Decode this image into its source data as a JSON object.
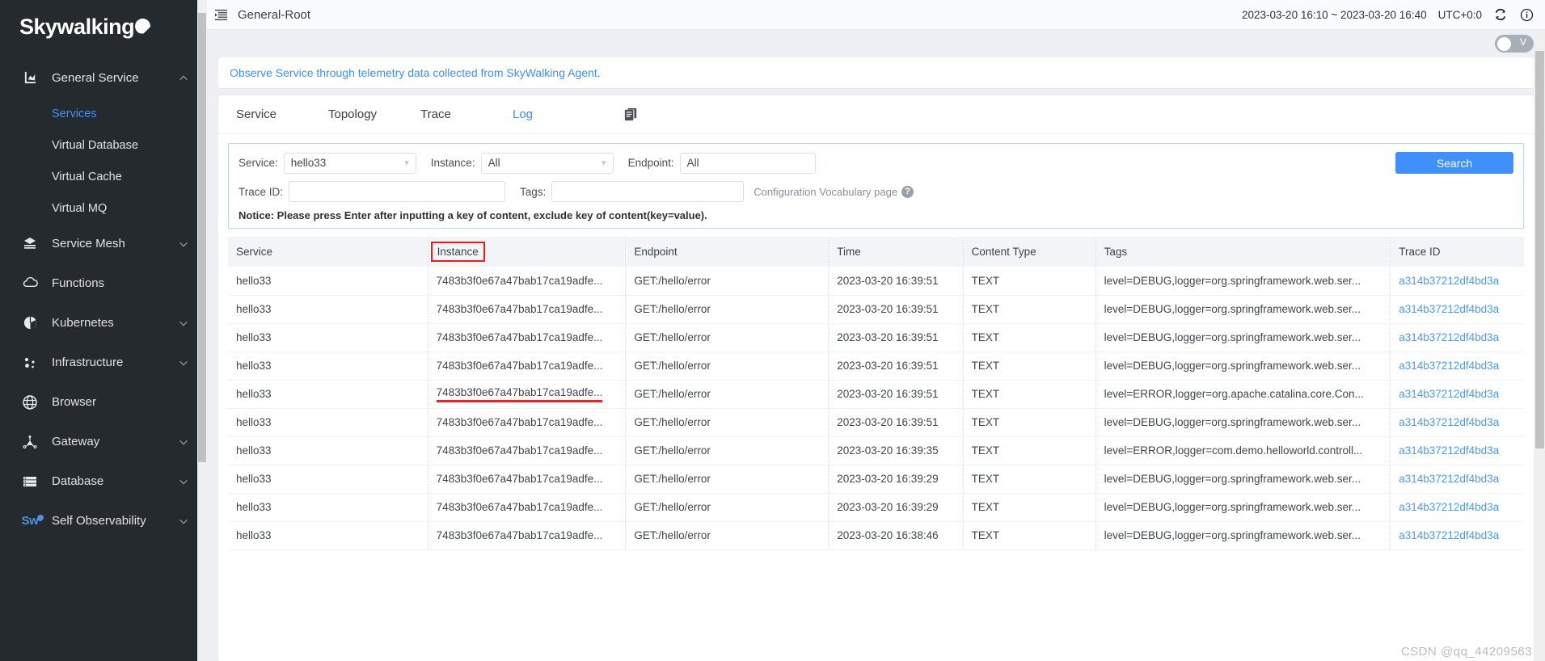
{
  "brand": {
    "name_part1": "Sky",
    "name_part2": "walking"
  },
  "sidebar": {
    "groups": [
      {
        "label": "General Service",
        "icon": "chart-icon",
        "expanded": true,
        "children": [
          {
            "label": "Services",
            "active": true
          },
          {
            "label": "Virtual Database",
            "active": false
          },
          {
            "label": "Virtual Cache",
            "active": false
          },
          {
            "label": "Virtual MQ",
            "active": false
          }
        ]
      },
      {
        "label": "Service Mesh",
        "icon": "mesh-icon",
        "expanded": false
      },
      {
        "label": "Functions",
        "icon": "cloud-icon",
        "expanded": null
      },
      {
        "label": "Kubernetes",
        "icon": "kubernetes-icon",
        "expanded": false
      },
      {
        "label": "Infrastructure",
        "icon": "infrastructure-icon",
        "expanded": false
      },
      {
        "label": "Browser",
        "icon": "globe-icon",
        "expanded": null
      },
      {
        "label": "Gateway",
        "icon": "gateway-icon",
        "expanded": false
      },
      {
        "label": "Database",
        "icon": "database-icon",
        "expanded": false
      },
      {
        "label": "Self Observability",
        "icon": "skywalking-mini-icon",
        "expanded": false
      }
    ]
  },
  "topbar": {
    "title": "General-Root",
    "time_range": "2023-03-20 16:10 ~ 2023-03-20 16:40",
    "timezone": "UTC+0:0",
    "reload_icon": "reload-icon",
    "info_icon": "info-icon",
    "collapse_icon": "collapse-sidebar-icon"
  },
  "viewswitch": {
    "label": "V"
  },
  "banner": {
    "text": "Observe Service through telemetry data collected from SkyWalking Agent."
  },
  "tabs": {
    "items": [
      {
        "label": "Service",
        "active": false
      },
      {
        "label": "Topology",
        "active": false
      },
      {
        "label": "Trace",
        "active": false
      },
      {
        "label": "Log",
        "active": true
      }
    ],
    "copy_icon": "copy-icon"
  },
  "search": {
    "service_label": "Service:",
    "service_value": "hello33",
    "instance_label": "Instance:",
    "instance_value": "All",
    "endpoint_label": "Endpoint:",
    "endpoint_value": "All",
    "traceid_label": "Trace ID:",
    "traceid_value": "",
    "traceid_placeholder": "",
    "tags_label": "Tags:",
    "tags_value": "",
    "tags_placeholder": "",
    "vocab_link": "Configuration Vocabulary page",
    "vocab_help_icon": "question-icon",
    "search_button": "Search",
    "notice": "Notice: Please press Enter after inputting a key of content, exclude key of content(key=value)."
  },
  "table": {
    "columns": [
      "Service",
      "Instance",
      "Endpoint",
      "Time",
      "Content Type",
      "Tags",
      "Trace ID"
    ],
    "highlighted_column": "Instance",
    "rows": [
      {
        "service": "hello33",
        "instance": "7483b3f0e67a47bab17ca19adfe...",
        "endpoint": "GET:/hello/error",
        "time": "2023-03-20 16:39:51",
        "content_type": "TEXT",
        "tags": "level=DEBUG,logger=org.springframework.web.ser...",
        "trace_id": "a314b37212df4bd3a",
        "highlight": false
      },
      {
        "service": "hello33",
        "instance": "7483b3f0e67a47bab17ca19adfe...",
        "endpoint": "GET:/hello/error",
        "time": "2023-03-20 16:39:51",
        "content_type": "TEXT",
        "tags": "level=DEBUG,logger=org.springframework.web.ser...",
        "trace_id": "a314b37212df4bd3a",
        "highlight": false
      },
      {
        "service": "hello33",
        "instance": "7483b3f0e67a47bab17ca19adfe...",
        "endpoint": "GET:/hello/error",
        "time": "2023-03-20 16:39:51",
        "content_type": "TEXT",
        "tags": "level=DEBUG,logger=org.springframework.web.ser...",
        "trace_id": "a314b37212df4bd3a",
        "highlight": false
      },
      {
        "service": "hello33",
        "instance": "7483b3f0e67a47bab17ca19adfe...",
        "endpoint": "GET:/hello/error",
        "time": "2023-03-20 16:39:51",
        "content_type": "TEXT",
        "tags": "level=DEBUG,logger=org.springframework.web.ser...",
        "trace_id": "a314b37212df4bd3a",
        "highlight": false
      },
      {
        "service": "hello33",
        "instance": "7483b3f0e67a47bab17ca19adfe...",
        "endpoint": "GET:/hello/error",
        "time": "2023-03-20 16:39:51",
        "content_type": "TEXT",
        "tags": "level=ERROR,logger=org.apache.catalina.core.Con...",
        "trace_id": "a314b37212df4bd3a",
        "highlight": true
      },
      {
        "service": "hello33",
        "instance": "7483b3f0e67a47bab17ca19adfe...",
        "endpoint": "GET:/hello/error",
        "time": "2023-03-20 16:39:51",
        "content_type": "TEXT",
        "tags": "level=DEBUG,logger=org.springframework.web.ser...",
        "trace_id": "a314b37212df4bd3a",
        "highlight": false
      },
      {
        "service": "hello33",
        "instance": "7483b3f0e67a47bab17ca19adfe...",
        "endpoint": "GET:/hello/error",
        "time": "2023-03-20 16:39:35",
        "content_type": "TEXT",
        "tags": "level=ERROR,logger=com.demo.helloworld.controll...",
        "trace_id": "a314b37212df4bd3a",
        "highlight": false
      },
      {
        "service": "hello33",
        "instance": "7483b3f0e67a47bab17ca19adfe...",
        "endpoint": "GET:/hello/error",
        "time": "2023-03-20 16:39:29",
        "content_type": "TEXT",
        "tags": "level=DEBUG,logger=org.springframework.web.ser...",
        "trace_id": "a314b37212df4bd3a",
        "highlight": false
      },
      {
        "service": "hello33",
        "instance": "7483b3f0e67a47bab17ca19adfe...",
        "endpoint": "GET:/hello/error",
        "time": "2023-03-20 16:39:29",
        "content_type": "TEXT",
        "tags": "level=DEBUG,logger=org.springframework.web.ser...",
        "trace_id": "a314b37212df4bd3a",
        "highlight": false
      },
      {
        "service": "hello33",
        "instance": "7483b3f0e67a47bab17ca19adfe...",
        "endpoint": "GET:/hello/error",
        "time": "2023-03-20 16:38:46",
        "content_type": "TEXT",
        "tags": "level=DEBUG,logger=org.springframework.web.ser...",
        "trace_id": "a314b37212df4bd3a",
        "highlight": false
      }
    ]
  },
  "watermark": {
    "text": "CSDN @qq_44209563"
  },
  "colors": {
    "accent": "#3f8ffd",
    "sidebar_bg": "#252a2f",
    "highlight_red": "#ee1d1d"
  }
}
